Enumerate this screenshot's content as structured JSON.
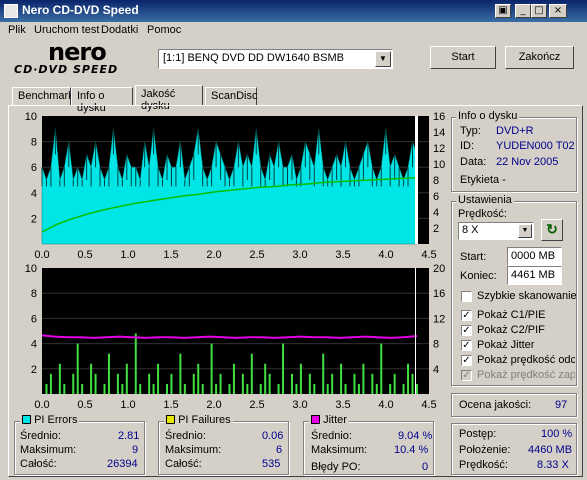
{
  "window": {
    "title": "Nero CD-DVD Speed",
    "min": "_",
    "max": "□",
    "close": "×"
  },
  "menu": [
    "Plik",
    "Uruchom test",
    "Dodatki",
    "Pomoc"
  ],
  "logo": {
    "top": "nero",
    "bottom": "CD·DVD SPEED"
  },
  "drive": {
    "selected": "[1:1]   BENQ DVD DD DW1640 BSMB"
  },
  "buttons": {
    "start": "Start",
    "close": "Zakończ"
  },
  "tabs": [
    "Benchmark",
    "Info o dysku",
    "Jakość dysku",
    "ScanDisc"
  ],
  "disc_info": {
    "group": "Info o dysku",
    "type_label": "Typ:",
    "type": "DVD+R",
    "id_label": "ID:",
    "id": "YUDEN000 T02",
    "date_label": "Data:",
    "date": "22 Nov 2005",
    "label_label": "Etykieta -"
  },
  "settings": {
    "group": "Ustawienia",
    "speed_label": "Prędkość:",
    "speed": "8 X",
    "start_label": "Start:",
    "start": "0000 MB",
    "end_label": "Koniec:",
    "end": "4461 MB",
    "quick_scan": "Szybkie skanowanie",
    "c1": "Pokaż C1/PIE",
    "c2": "Pokaż C2/PIF",
    "jitter": "Pokaż Jitter",
    "speed_show": "Pokaż prędkość odczy",
    "speed_write": "Pokaż prędkość zapisu"
  },
  "quality": {
    "label": "Ocena jakości:",
    "value": "97"
  },
  "progress": {
    "progress_label": "Postęp:",
    "progress": "100 %",
    "position_label": "Położenie:",
    "position": "4460 MB",
    "speed_label": "Prędkość:",
    "speed": "8.33 X"
  },
  "pi_errors": {
    "title": "PI Errors",
    "avg_label": "Średnio:",
    "avg": "2.81",
    "max_label": "Maksimum:",
    "max": "9",
    "total_label": "Całość:",
    "total": "26394",
    "color": "#00e5e5"
  },
  "pi_failures": {
    "title": "PI Failures",
    "avg_label": "Średnio:",
    "avg": "0.06",
    "max_label": "Maksimum:",
    "max": "6",
    "total_label": "Całość:",
    "total": "535",
    "color": "#e5e500"
  },
  "jitter": {
    "title": "Jitter",
    "avg_label": "Średnio:",
    "avg": "9.04 %",
    "max_label": "Maksimum:",
    "max": "10.4 %",
    "po_label": "Błędy PO:",
    "po": "0",
    "color": "#e500e5"
  },
  "chart_data": [
    {
      "type": "bar",
      "series": [
        {
          "name": "PI Errors",
          "values": [
            6,
            5,
            6,
            9,
            5,
            6,
            8,
            5,
            6,
            5,
            7,
            6,
            8,
            6,
            5,
            6,
            9,
            6,
            5,
            7,
            6,
            6,
            5,
            8,
            6,
            9,
            6,
            5,
            7,
            6,
            6,
            8,
            5,
            6,
            7,
            9,
            6,
            5,
            6,
            8,
            7,
            6,
            5,
            6,
            8,
            6,
            7,
            6,
            9,
            6,
            5,
            7,
            6,
            8,
            6,
            6,
            7,
            5,
            6,
            8,
            7,
            6,
            9,
            6,
            5,
            6,
            7,
            6,
            8,
            6,
            5,
            6,
            7,
            8,
            6,
            5,
            6,
            9,
            6,
            7,
            6,
            5,
            6,
            8,
            7
          ]
        },
        {
          "name": "Speed",
          "values": [
            1.5,
            2.5,
            3.2,
            3.8,
            4.3,
            4.7,
            5.1,
            5.4,
            5.7,
            6.0,
            6.2,
            6.5,
            6.7,
            6.9,
            7.1,
            7.2,
            7.4,
            7.5,
            7.7,
            7.8,
            7.9,
            8.0,
            8.1,
            8.2,
            8.3
          ]
        }
      ],
      "xlim": [
        0,
        4.5
      ],
      "ylim": [
        0,
        10
      ],
      "y2lim": [
        0,
        16
      ],
      "xticks": [
        "0.0",
        "0.5",
        "1.0",
        "1.5",
        "2.0",
        "2.5",
        "3.0",
        "3.5",
        "4.0",
        "4.5"
      ],
      "yticks": [
        "10",
        "8",
        "6",
        "4",
        "2"
      ],
      "y2ticks": [
        "16",
        "14",
        "12",
        "10",
        "8",
        "6",
        "4",
        "2"
      ]
    },
    {
      "type": "bar",
      "series": [
        {
          "name": "PI Failures",
          "values": [
            0,
            1,
            2,
            0,
            3,
            1,
            0,
            2,
            5,
            1,
            0,
            3,
            2,
            0,
            1,
            4,
            0,
            2,
            1,
            3,
            0,
            6,
            1,
            0,
            2,
            1,
            3,
            0,
            1,
            2,
            0,
            4,
            1,
            0,
            2,
            3,
            1,
            0,
            5,
            1,
            2,
            0,
            1,
            3,
            0,
            2,
            1,
            4,
            0,
            1,
            3,
            2,
            0,
            1,
            5,
            0,
            2,
            1,
            3,
            0,
            2,
            1,
            0,
            4,
            1,
            2,
            0,
            3,
            1,
            0,
            2,
            1,
            3,
            0,
            2,
            1,
            5,
            0,
            1,
            2,
            0,
            1,
            3,
            2,
            1
          ]
        },
        {
          "name": "Jitter",
          "values": [
            9.3,
            9.1,
            9.0,
            9.0,
            8.9,
            9.0,
            9.1,
            9.0,
            8.9,
            9.0,
            9.0,
            8.9,
            9.0,
            9.1,
            9.0,
            8.9,
            9.0,
            9.0,
            8.9,
            9.0,
            9.1,
            9.0,
            9.0,
            8.9,
            9.0,
            9.1,
            9.0,
            8.9,
            9.0,
            9.2
          ]
        }
      ],
      "xlim": [
        0,
        4.5
      ],
      "ylim": [
        0,
        10
      ],
      "y2lim": [
        0,
        20
      ],
      "xticks": [
        "0.0",
        "0.5",
        "1.0",
        "1.5",
        "2.0",
        "2.5",
        "3.0",
        "3.5",
        "4.0",
        "4.5"
      ],
      "yticks": [
        "10",
        "8",
        "6",
        "4",
        "2"
      ],
      "y2ticks": [
        "20",
        "16",
        "12",
        "8",
        "4"
      ]
    }
  ]
}
